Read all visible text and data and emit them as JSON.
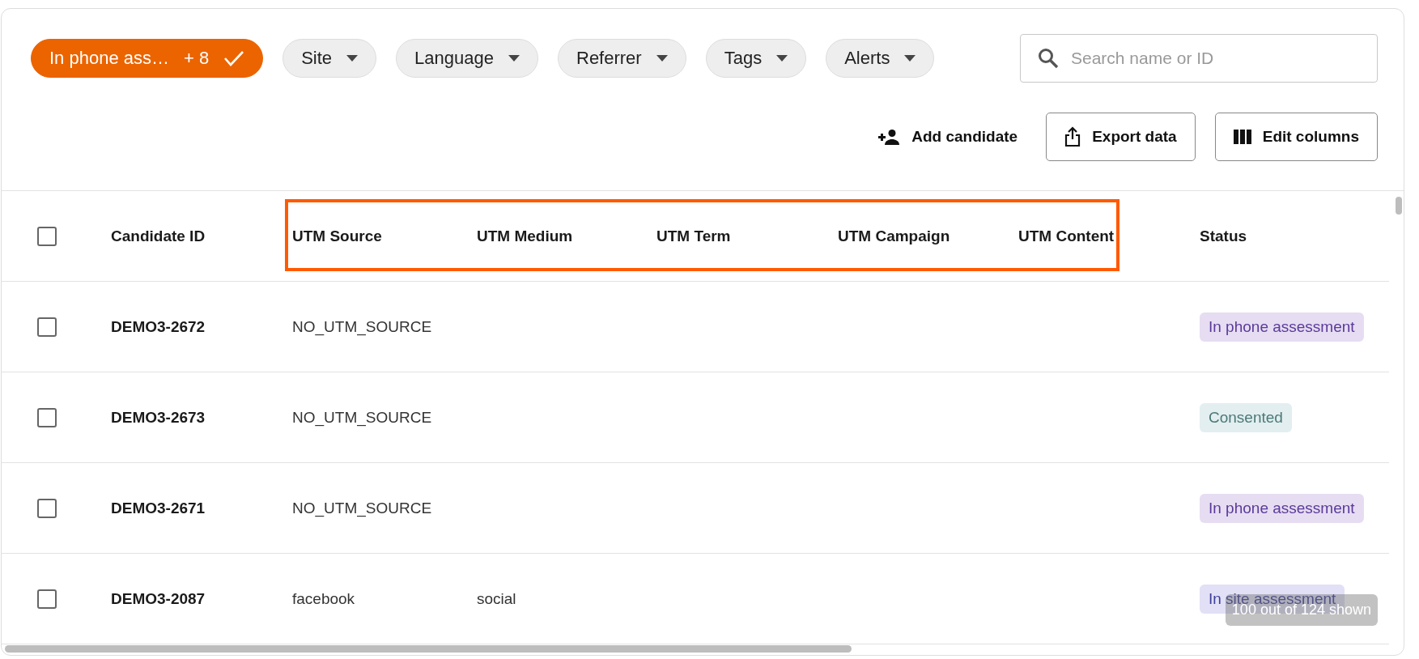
{
  "filters": [
    {
      "label": "In phone ass…",
      "count": "+ 8",
      "active": true
    },
    {
      "label": "Site",
      "active": false
    },
    {
      "label": "Language",
      "active": false
    },
    {
      "label": "Referrer",
      "active": false
    },
    {
      "label": "Tags",
      "active": false
    },
    {
      "label": "Alerts",
      "active": false
    }
  ],
  "search": {
    "placeholder": "Search name or ID"
  },
  "actions": [
    {
      "label": "Add candidate",
      "kind": "add"
    },
    {
      "label": "Export data",
      "kind": "export"
    },
    {
      "label": "Edit columns",
      "kind": "columns"
    }
  ],
  "table": {
    "select_all": {
      "checked": false
    },
    "columns": [
      {
        "kind": "column",
        "label": "Candidate ID"
      },
      {
        "kind": "highlight_group",
        "columns": [
          "UTM Source",
          "UTM Medium",
          "UTM Term",
          "UTM Campaign",
          "UTM Content"
        ]
      },
      {
        "kind": "column",
        "label": "Status"
      }
    ],
    "rows": [
      {
        "checked": false,
        "candidate_id": "DEMO3-2672",
        "utm_source": "NO_UTM_SOURCE",
        "status": {
          "label": "In phone assessment",
          "kind": "phone"
        }
      },
      {
        "checked": false,
        "candidate_id": "DEMO3-2673",
        "utm_source": "NO_UTM_SOURCE",
        "status": {
          "label": "Consented",
          "kind": "consented"
        }
      },
      {
        "checked": false,
        "candidate_id": "DEMO3-2671",
        "utm_source": "NO_UTM_SOURCE",
        "status": {
          "label": "In phone assessment",
          "kind": "phone"
        }
      },
      {
        "checked": false,
        "candidate_id": "DEMO3-2087",
        "utm_source": "facebook",
        "utm_medium": "social",
        "status": {
          "label": "In site assessment",
          "kind": "site"
        }
      }
    ]
  },
  "toast": "100 out of 124 shown"
}
